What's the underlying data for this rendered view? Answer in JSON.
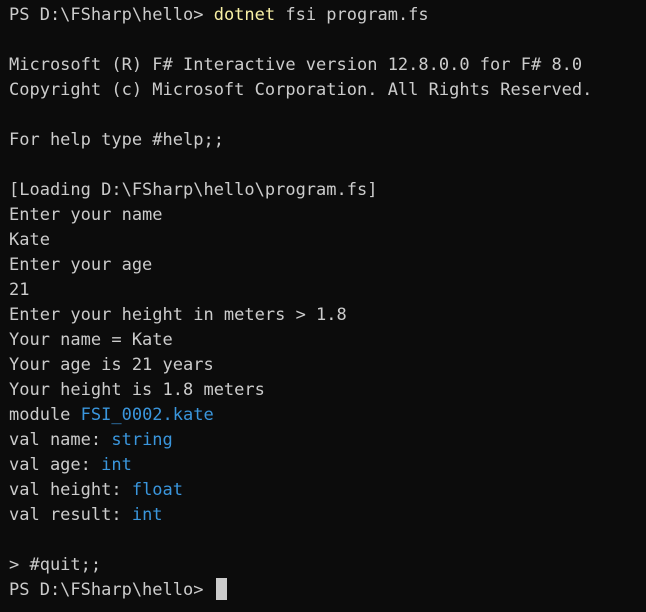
{
  "colors": {
    "background": "#0c0c0c",
    "foreground": "#cccccc",
    "command": "#f9f1a5",
    "type": "#3a96dd"
  },
  "session": {
    "prompt1": "PS D:\\FSharp\\hello> ",
    "command": "dotnet",
    "command_args": " fsi program.fs",
    "banner1": "Microsoft (R) F# Interactive version 12.8.0.0 for F# 8.0",
    "banner2": "Copyright (c) Microsoft Corporation. All Rights Reserved.",
    "help": "For help type #help;;",
    "loading": "[Loading D:\\FSharp\\hello\\program.fs]",
    "ask_name": "Enter your name",
    "input_name": "Kate",
    "ask_age": "Enter your age",
    "input_age": "21",
    "ask_height": "Enter your height in meters > 1.8",
    "out_name": "Your name = Kate",
    "out_age": "Your age is 21 years",
    "out_height": "Your height is 1.8 meters",
    "module_kw": "module ",
    "module_name": "FSI_0002.kate",
    "val_name": "val name: ",
    "type_name": "string",
    "val_age": "val age: ",
    "type_age": "int",
    "val_height": "val height: ",
    "type_height": "float",
    "val_result": "val result: ",
    "type_result": "int",
    "quit": "> #quit;;",
    "prompt2": "PS D:\\FSharp\\hello> "
  }
}
